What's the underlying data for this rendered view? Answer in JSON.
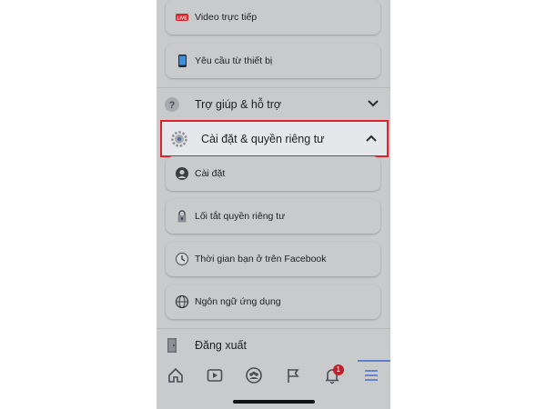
{
  "menu": {
    "top_items": [
      {
        "label": "Video trực tiếp",
        "icon": "live-video-icon"
      },
      {
        "label": "Yêu cầu từ thiết bị",
        "icon": "device-request-icon"
      }
    ],
    "help_section": {
      "label": "Trợ giúp & hỗ trợ",
      "icon": "help-icon",
      "expanded": false
    },
    "settings_section": {
      "label": "Cài đặt & quyền riêng tư",
      "icon": "gear-icon",
      "expanded": true
    },
    "settings_items": [
      {
        "label": "Cài đặt",
        "icon": "profile-icon"
      },
      {
        "label": "Lối tắt quyền riêng tư",
        "icon": "lock-icon"
      },
      {
        "label": "Thời gian bạn ở trên Facebook",
        "icon": "clock-icon"
      },
      {
        "label": "Ngôn ngữ ứng dụng",
        "icon": "globe-icon"
      }
    ],
    "logout": {
      "label": "Đăng xuất",
      "icon": "door-icon"
    }
  },
  "tabbar": {
    "tabs": [
      "home-icon",
      "video-icon",
      "groups-icon",
      "flag-icon",
      "bell-icon",
      "menu-icon"
    ],
    "notification_count": "1",
    "active": "menu-icon"
  },
  "colors": {
    "highlight_border": "#e0212b",
    "accent": "#5b7fd0",
    "badge": "#c0202a"
  }
}
